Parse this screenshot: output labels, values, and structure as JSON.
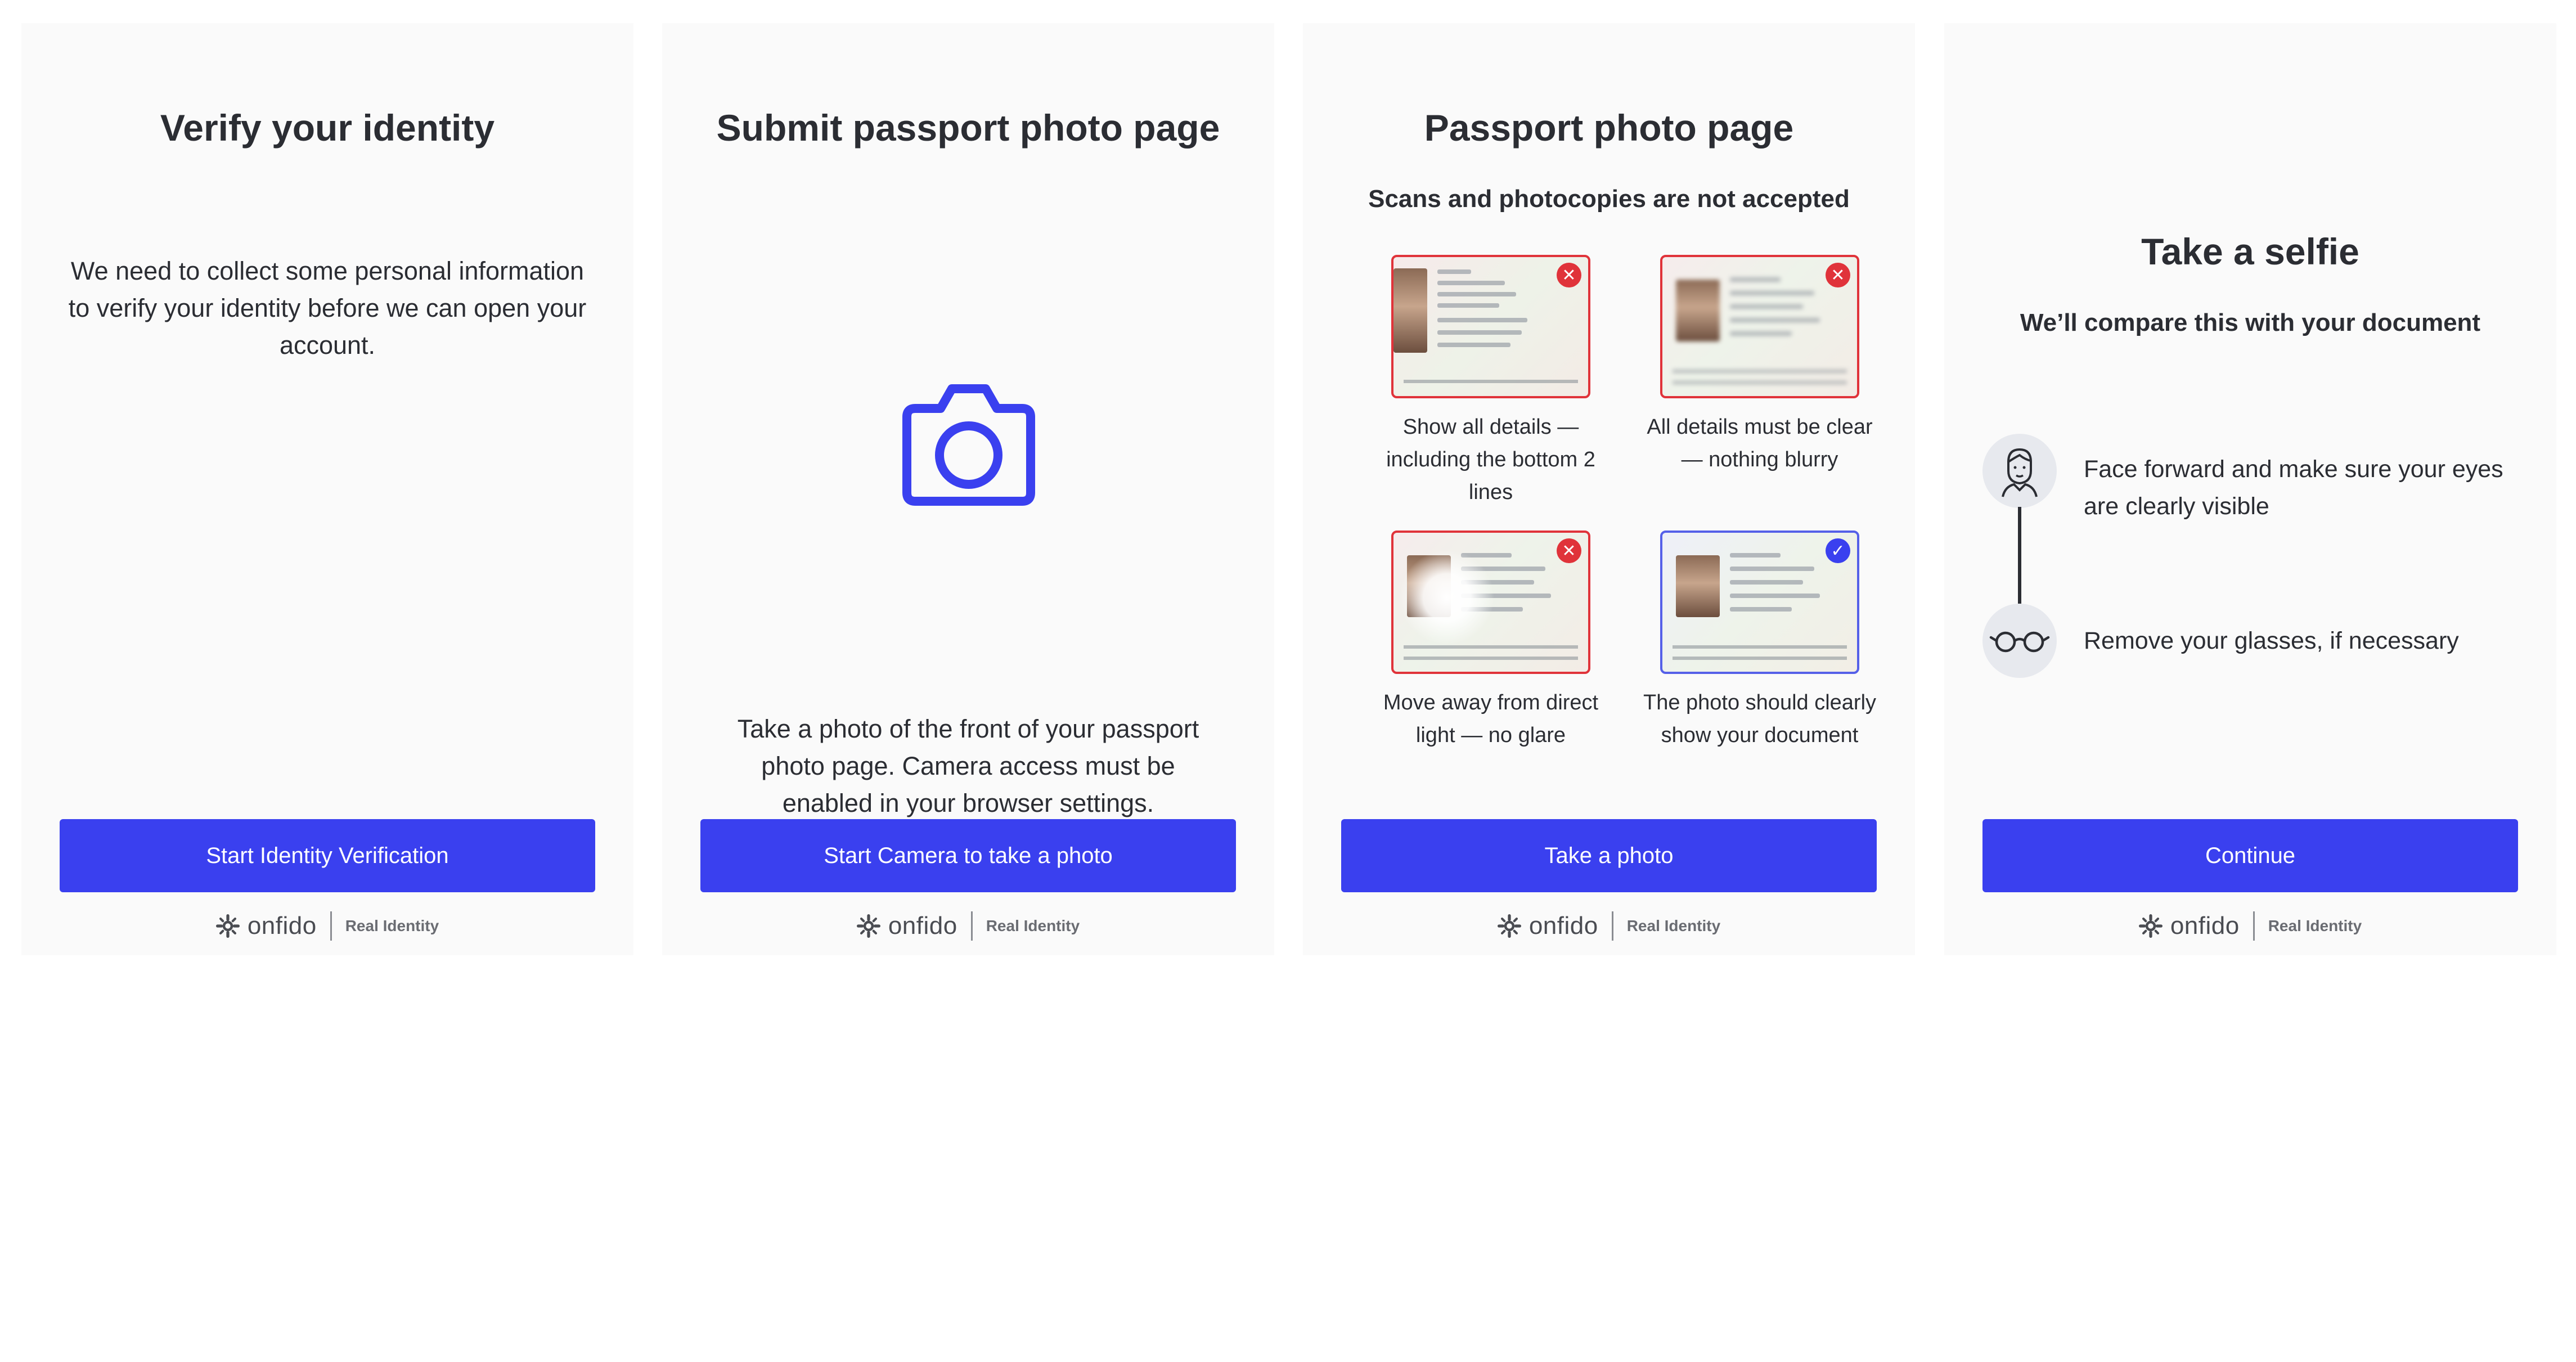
{
  "brand": {
    "wordmark": "onfido",
    "tagline": "Real Identity"
  },
  "colors": {
    "primary_button": "#3a40ef",
    "panel_background": "#fafafa",
    "error": "#e0333a",
    "success": "#3a40ef"
  },
  "screen1": {
    "title": "Verify your identity",
    "body": "We need to collect some personal information to verify your identity before we can open your account.",
    "button": "Start Identity Verification"
  },
  "screen2": {
    "title": "Submit passport photo page",
    "icon": "camera-icon",
    "body": "Take a photo of the front of your passport photo page. Camera access must be enabled in your browser settings.",
    "button": "Start Camera to take a photo"
  },
  "screen3": {
    "title": "Passport photo page",
    "subtitle": "Scans and photocopies are not accepted",
    "examples": [
      {
        "caption": "Show all details — including the bottom 2 lines",
        "status": "invalid"
      },
      {
        "caption": "All details must be clear — nothing blurry",
        "status": "invalid"
      },
      {
        "caption": "Move away from direct light — no glare",
        "status": "invalid"
      },
      {
        "caption": "The photo should clearly show your document",
        "status": "valid"
      }
    ],
    "button": "Take a photo"
  },
  "screen4": {
    "title": "Take a selfie",
    "subtitle": "We’ll compare this with your document",
    "tips": [
      {
        "icon": "face-icon",
        "text": "Face forward and make sure your eyes are clearly visible"
      },
      {
        "icon": "glasses-icon",
        "text": "Remove your glasses, if necessary"
      }
    ],
    "button": "Continue"
  }
}
